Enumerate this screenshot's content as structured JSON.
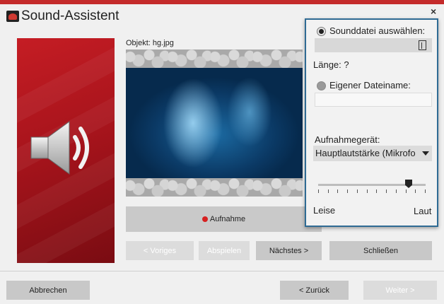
{
  "window": {
    "title": "Sound-Assistent",
    "close_glyph": "×"
  },
  "preview": {
    "object_label": "Objekt: hg.jpg"
  },
  "controls": {
    "record": "Aufnahme",
    "previous": "< Voriges",
    "play": "Abspielen",
    "next": "Nächstes >",
    "close": "Schließen"
  },
  "footer": {
    "cancel": "Abbrechen",
    "back": "< Zurück",
    "forward": "Weiter >"
  },
  "popup": {
    "select_sound_file": "Sounddatei auswählen:",
    "sound_file_value": "",
    "length_label": "Länge: ?",
    "own_filename": "Eigener Dateiname:",
    "own_filename_value": "",
    "device_label": "Aufnahmegerät:",
    "device_value": "Hauptlautstärke (Mikrofo",
    "volume_low": "Leise",
    "volume_high": "Laut",
    "volume_level": 0.84,
    "selected_option": "Sounddatei auswählen"
  },
  "colors": {
    "accent_red": "#c42b2b",
    "popup_border": "#2f6b94"
  },
  "icons": [
    "app-logo-icon",
    "speaker-icon",
    "record-dot-icon",
    "file-browse-icon",
    "chevron-down-icon"
  ]
}
